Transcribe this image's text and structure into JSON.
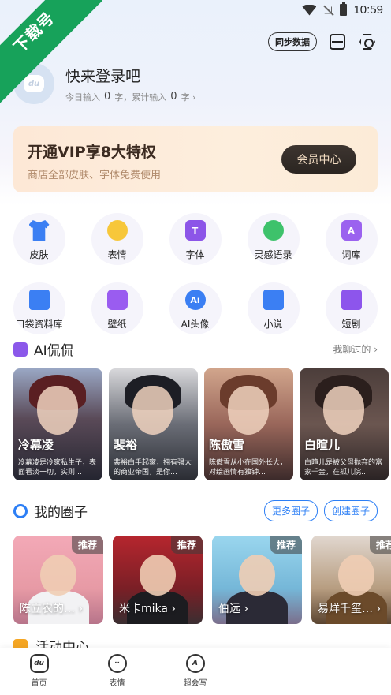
{
  "status_bar": {
    "time": "10:59"
  },
  "ribbon": {
    "text": "下载号"
  },
  "top_actions": {
    "sync_label": "同步数据"
  },
  "profile": {
    "title": "快来登录吧",
    "today_label": "今日输入",
    "today_count": "0",
    "today_unit": "字，累计输入",
    "total_count": "0",
    "total_unit": "字 ›",
    "avatar_text": "du"
  },
  "vip": {
    "title": "开通VIP享8大特权",
    "subtitle": "商店全部皮肤、字体免费使用",
    "button": "会员中心"
  },
  "features": [
    {
      "label": "皮肤",
      "icon": "shirt-icon"
    },
    {
      "label": "表情",
      "icon": "emoji-icon"
    },
    {
      "label": "字体",
      "icon": "font-icon"
    },
    {
      "label": "灵感语录",
      "icon": "quote-chat-icon"
    },
    {
      "label": "词库",
      "icon": "dictionary-icon"
    },
    {
      "label": "口袋资料库",
      "icon": "folder-icon"
    },
    {
      "label": "壁纸",
      "icon": "wallpaper-icon"
    },
    {
      "label": "AI头像",
      "icon": "ai-avatar-icon"
    },
    {
      "label": "小说",
      "icon": "novel-icon"
    },
    {
      "label": "短剧",
      "icon": "short-drama-icon"
    }
  ],
  "ai_chat": {
    "title": "AI侃侃",
    "link": "我聊过的 ›",
    "cards": [
      {
        "name": "冷幕凌",
        "desc": "冷幕凌是冷家私生子，表面看淡一切，实则…"
      },
      {
        "name": "裴裕",
        "desc": "裴裕白手起家，拥有强大的商业帝国，是你…"
      },
      {
        "name": "陈傲雪",
        "desc": "陈傲雪从小在国外长大，对绘画情有独钟…"
      },
      {
        "name": "白暄儿",
        "desc": "白暄儿是被父母抛弃的富家千金，在孤儿院…"
      }
    ]
  },
  "circles": {
    "title": "我的圈子",
    "more_button": "更多圈子",
    "create_button": "创建圈子",
    "cards": [
      {
        "name": "陈立农的… ›",
        "badge": "推荐"
      },
      {
        "name": "米卡mika ›",
        "badge": "推荐"
      },
      {
        "name": "伯远 ›",
        "badge": "推荐"
      },
      {
        "name": "易烊千玺… ›",
        "badge": "推荐"
      }
    ]
  },
  "activity": {
    "title": "活动中心"
  },
  "tabbar": [
    {
      "label": "首页",
      "icon_text": "du"
    },
    {
      "label": "表情",
      "icon_text": "··"
    },
    {
      "label": "超会写",
      "icon_text": "A"
    }
  ],
  "colors": {
    "brand_green": "#17a25a",
    "accent_blue": "#2d7ff5",
    "purple": "#8c55e8"
  }
}
